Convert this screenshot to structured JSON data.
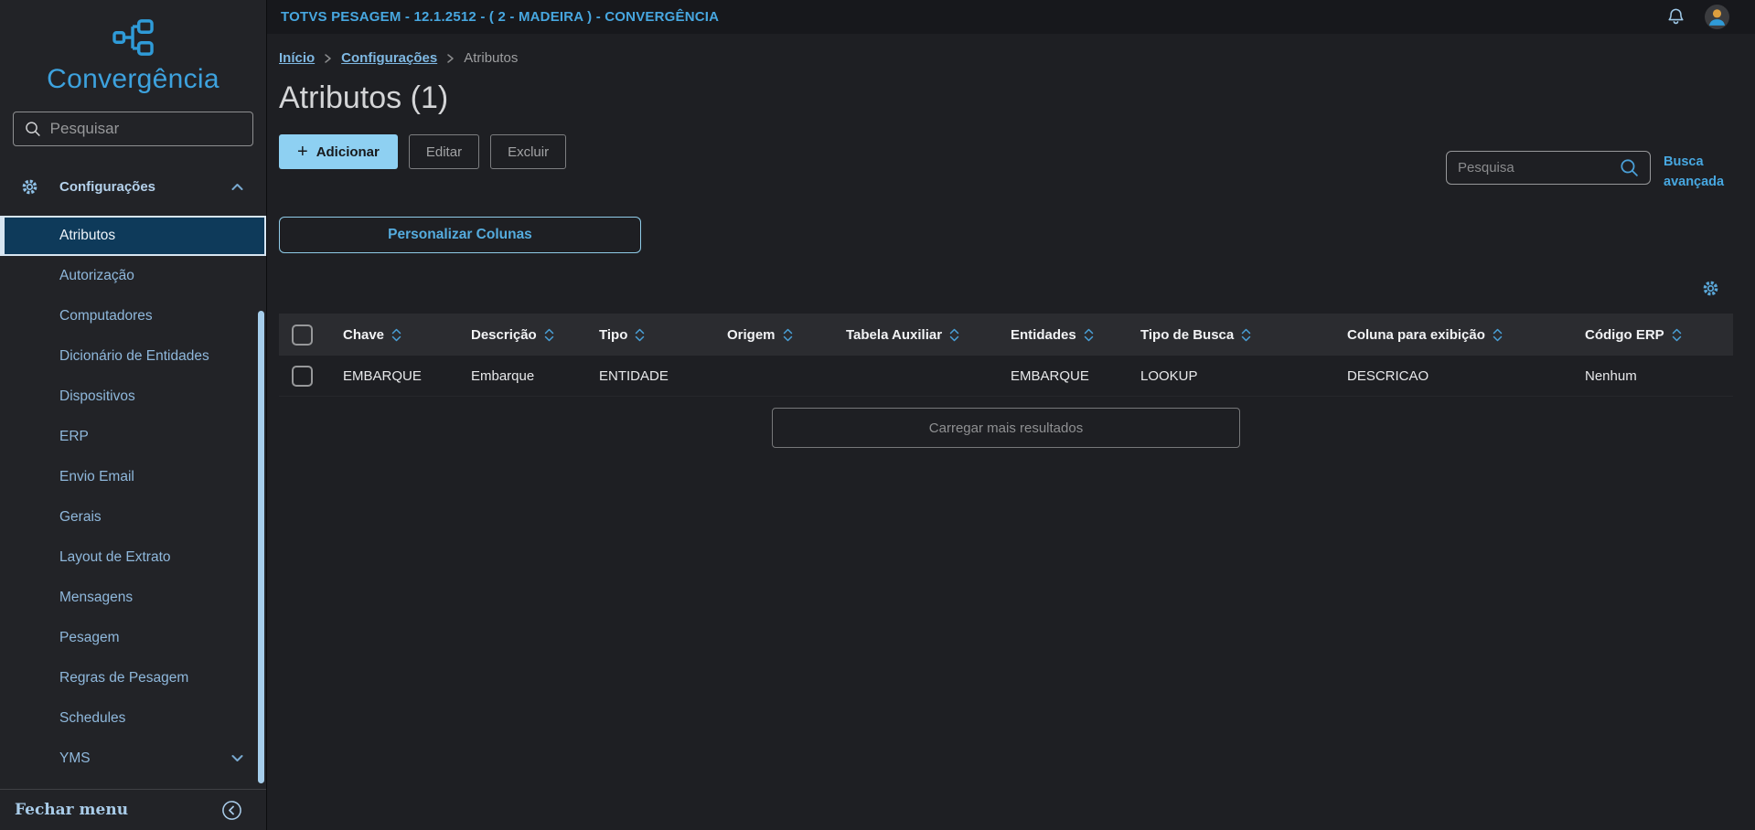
{
  "app": {
    "topbar_title": "TOTVS PESAGEM - 12.1.2512 - ( 2 - MADEIRA ) - CONVERGÊNCIA"
  },
  "colors": {
    "accent_blue": "#47a7e0",
    "light_blue_button": "#8ed0f2",
    "selected_item_bg": "#0e3a5a",
    "menu_text": "#8fb8dc",
    "sidebar_bg": "#222327",
    "topbar_bg": "#17181c",
    "table_header_bg": "#2b2c30"
  },
  "sidebar": {
    "title": "Convergência",
    "search": {
      "placeholder": "Pesquisar",
      "icon": "search-icon"
    },
    "menu": {
      "section": {
        "label": "Configurações",
        "icon": "gear-icon",
        "state_icon": "chevron-up-icon"
      },
      "items": [
        {
          "label": "Atributos",
          "selected": true
        },
        {
          "label": "Autorização"
        },
        {
          "label": "Computadores"
        },
        {
          "label": "Dicionário de Entidades"
        },
        {
          "label": "Dispositivos"
        },
        {
          "label": "ERP"
        },
        {
          "label": "Envio Email"
        },
        {
          "label": "Gerais"
        },
        {
          "label": "Layout de Extrato"
        },
        {
          "label": "Mensagens"
        },
        {
          "label": "Pesagem"
        },
        {
          "label": "Regras de Pesagem"
        },
        {
          "label": "Schedules"
        },
        {
          "label": "YMS",
          "state_icon": "chevron-down-icon"
        }
      ]
    },
    "footer": {
      "label": "Fechar menu",
      "icon": "collapse-circle-icon"
    }
  },
  "topbar": {
    "icons": [
      "bell-icon",
      "user-avatar"
    ]
  },
  "breadcrumb": {
    "home": "Início",
    "section": "Configurações",
    "current": "Atributos"
  },
  "page": {
    "title": "Atributos (1)",
    "actions": {
      "add": "Adicionar",
      "edit": "Editar",
      "delete": "Excluir",
      "customize_columns": "Personalizar Colunas"
    },
    "search": {
      "placeholder": "Pesquisa",
      "icon": "search-icon"
    },
    "advanced_search": "Busca avançada",
    "load_more": "Carregar mais resultados"
  },
  "table": {
    "columns": [
      "Chave",
      "Descrição",
      "Tipo",
      "Origem",
      "Tabela Auxiliar",
      "Entidades",
      "Tipo de Busca",
      "Coluna para exibição",
      "Código ERP"
    ],
    "rows": [
      {
        "cells": [
          "EMBARQUE",
          "Embarque",
          "ENTIDADE",
          "",
          "",
          "EMBARQUE",
          "LOOKUP",
          "DESCRICAO",
          "Nenhum"
        ]
      }
    ]
  }
}
